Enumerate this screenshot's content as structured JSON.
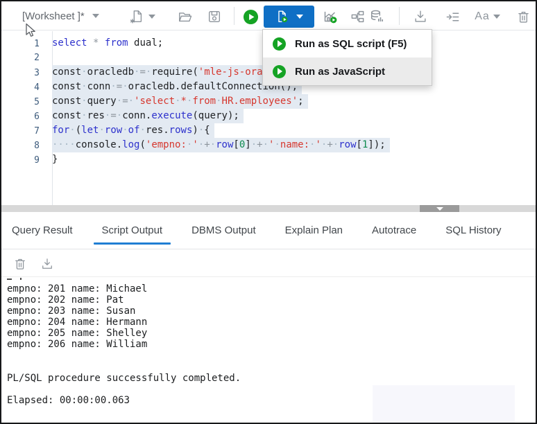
{
  "window": {
    "title": "[Worksheet ]*"
  },
  "toolbar": {
    "font_label": "Aa",
    "icons": [
      "new-worksheet",
      "open-file",
      "save",
      "run-statement",
      "run-script",
      "autotrace",
      "explain-plan",
      "sql-monitor",
      "download",
      "format",
      "text-size",
      "clear"
    ]
  },
  "run_menu": {
    "items": [
      {
        "label": "Run as SQL script (F5)",
        "icon": "play"
      },
      {
        "label": "Run as JavaScript",
        "icon": "play",
        "hover": true
      }
    ]
  },
  "editor": {
    "lines": [
      {
        "n": "1",
        "tokens": [
          {
            "t": "select",
            "c": "kw"
          },
          {
            "t": " ",
            "c": "sp"
          },
          {
            "t": "*",
            "c": "op"
          },
          {
            "t": " ",
            "c": "sp"
          },
          {
            "t": "from",
            "c": "kw"
          },
          {
            "t": " ",
            "c": "sp"
          },
          {
            "t": "dual;",
            "c": "pl"
          }
        ]
      },
      {
        "n": "2",
        "tokens": []
      },
      {
        "n": "3",
        "sel": true,
        "tokens": [
          {
            "t": "const",
            "c": "pl"
          },
          {
            "t": "·",
            "c": "ws"
          },
          {
            "t": "oracledb",
            "c": "pl"
          },
          {
            "t": "·",
            "c": "ws"
          },
          {
            "t": "=",
            "c": "op"
          },
          {
            "t": "·",
            "c": "ws"
          },
          {
            "t": "require(",
            "c": "pl"
          },
          {
            "t": "'mle-js-oracledb'",
            "c": "str"
          },
          {
            "t": ");",
            "c": "pl"
          }
        ]
      },
      {
        "n": "4",
        "sel": true,
        "tokens": [
          {
            "t": "const",
            "c": "pl"
          },
          {
            "t": "·",
            "c": "ws"
          },
          {
            "t": "conn",
            "c": "pl"
          },
          {
            "t": "·",
            "c": "ws"
          },
          {
            "t": "=",
            "c": "op"
          },
          {
            "t": "·",
            "c": "ws"
          },
          {
            "t": "oracledb.defaultConnection();",
            "c": "pl"
          }
        ]
      },
      {
        "n": "5",
        "sel": true,
        "tokens": [
          {
            "t": "const",
            "c": "pl"
          },
          {
            "t": "·",
            "c": "ws"
          },
          {
            "t": "query",
            "c": "pl"
          },
          {
            "t": "·",
            "c": "ws"
          },
          {
            "t": "=",
            "c": "op"
          },
          {
            "t": "·",
            "c": "ws"
          },
          {
            "t": "'select",
            "c": "str"
          },
          {
            "t": "·",
            "c": "ws"
          },
          {
            "t": "*",
            "c": "str"
          },
          {
            "t": "·",
            "c": "ws"
          },
          {
            "t": "from",
            "c": "str"
          },
          {
            "t": "·",
            "c": "ws"
          },
          {
            "t": "HR.employees'",
            "c": "str"
          },
          {
            "t": ";",
            "c": "pl"
          }
        ]
      },
      {
        "n": "6",
        "sel": true,
        "tokens": [
          {
            "t": "const",
            "c": "pl"
          },
          {
            "t": "·",
            "c": "ws"
          },
          {
            "t": "res",
            "c": "pl"
          },
          {
            "t": "·",
            "c": "ws"
          },
          {
            "t": "=",
            "c": "op"
          },
          {
            "t": "·",
            "c": "ws"
          },
          {
            "t": "conn.",
            "c": "pl"
          },
          {
            "t": "execute",
            "c": "fn"
          },
          {
            "t": "(query);",
            "c": "pl"
          }
        ]
      },
      {
        "n": "7",
        "sel": true,
        "tokens": [
          {
            "t": "for",
            "c": "kw"
          },
          {
            "t": "·",
            "c": "ws"
          },
          {
            "t": "(",
            "c": "pl"
          },
          {
            "t": "let",
            "c": "kw"
          },
          {
            "t": "·",
            "c": "ws"
          },
          {
            "t": "row",
            "c": "fn"
          },
          {
            "t": "·",
            "c": "ws"
          },
          {
            "t": "of",
            "c": "kw"
          },
          {
            "t": "·",
            "c": "ws"
          },
          {
            "t": "res.",
            "c": "pl"
          },
          {
            "t": "rows",
            "c": "fn"
          },
          {
            "t": ")",
            "c": "pl"
          },
          {
            "t": "·",
            "c": "ws"
          },
          {
            "t": "{",
            "c": "pl"
          }
        ]
      },
      {
        "n": "8",
        "sel": true,
        "tokens": [
          {
            "t": "····",
            "c": "ws"
          },
          {
            "t": "console.",
            "c": "pl"
          },
          {
            "t": "log",
            "c": "fn"
          },
          {
            "t": "(",
            "c": "pl"
          },
          {
            "t": "'empno:",
            "c": "str"
          },
          {
            "t": "·",
            "c": "ws"
          },
          {
            "t": "'",
            "c": "str"
          },
          {
            "t": "·",
            "c": "ws"
          },
          {
            "t": "+",
            "c": "op"
          },
          {
            "t": "·",
            "c": "ws"
          },
          {
            "t": "row",
            "c": "fn"
          },
          {
            "t": "[",
            "c": "pl"
          },
          {
            "t": "0",
            "c": "num"
          },
          {
            "t": "]",
            "c": "pl"
          },
          {
            "t": "·",
            "c": "ws"
          },
          {
            "t": "+",
            "c": "op"
          },
          {
            "t": "·",
            "c": "ws"
          },
          {
            "t": "'",
            "c": "str"
          },
          {
            "t": "·",
            "c": "ws"
          },
          {
            "t": "name:",
            "c": "str"
          },
          {
            "t": "·",
            "c": "ws"
          },
          {
            "t": "'",
            "c": "str"
          },
          {
            "t": "·",
            "c": "ws"
          },
          {
            "t": "+",
            "c": "op"
          },
          {
            "t": "·",
            "c": "ws"
          },
          {
            "t": "row",
            "c": "fn"
          },
          {
            "t": "[",
            "c": "pl"
          },
          {
            "t": "1",
            "c": "num"
          },
          {
            "t": "]",
            "c": "pl"
          },
          {
            "t": ");",
            "c": "pl"
          }
        ]
      },
      {
        "n": "9",
        "tokens": [
          {
            "t": "}",
            "c": "pl"
          }
        ]
      }
    ]
  },
  "tabs": [
    {
      "label": "Query Result"
    },
    {
      "label": "Script Output",
      "active": true
    },
    {
      "label": "DBMS Output"
    },
    {
      "label": "Explain Plan"
    },
    {
      "label": "Autotrace"
    },
    {
      "label": "SQL History"
    }
  ],
  "output": {
    "toolbar_icons": [
      "clear-output",
      "download-output"
    ],
    "lines": [
      "empno: 201 name: Michael",
      "empno: 202 name: Pat",
      "empno: 203 name: Susan",
      "empno: 204 name: Hermann",
      "empno: 205 name: Shelley",
      "empno: 206 name: William"
    ],
    "status": "PL/SQL procedure successfully completed.",
    "elapsed": "Elapsed: 00:00:00.063"
  },
  "colors": {
    "accent_blue": "#0f6fc5",
    "tab_underline": "#1f7ed3",
    "run_green": "#15a324",
    "selection": "#e3eaf2",
    "keyword": "#2d31cc",
    "string": "#d6372e",
    "number": "#0d8a4e"
  }
}
